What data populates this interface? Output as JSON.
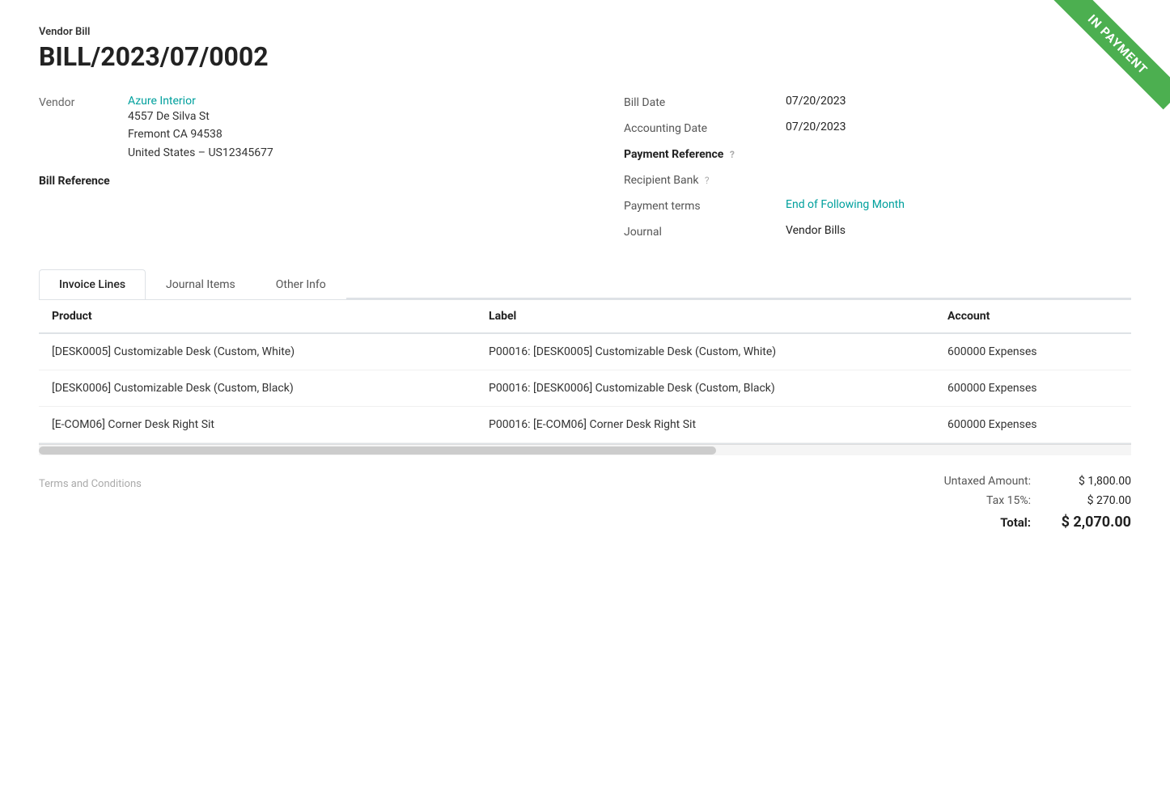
{
  "ribbon": {
    "label": "IN PAYMENT"
  },
  "header": {
    "vendor_bill_label": "Vendor Bill",
    "bill_number": "BILL/2023/07/0002"
  },
  "vendor": {
    "label": "Vendor",
    "name": "Azure Interior",
    "address_line1": "4557 De Silva St",
    "address_line2": "Fremont CA 94538",
    "address_line3": "United States – US12345677"
  },
  "bill_reference": {
    "label": "Bill Reference"
  },
  "fields": {
    "bill_date_label": "Bill Date",
    "bill_date_value": "07/20/2023",
    "accounting_date_label": "Accounting Date",
    "accounting_date_value": "07/20/2023",
    "payment_reference_label": "Payment Reference",
    "payment_reference_help": "?",
    "payment_reference_value": "",
    "recipient_bank_label": "Recipient Bank",
    "recipient_bank_help": "?",
    "recipient_bank_value": "",
    "payment_terms_label": "Payment terms",
    "payment_terms_value": "End of Following Month",
    "journal_label": "Journal",
    "journal_value": "Vendor Bills"
  },
  "tabs": [
    {
      "id": "invoice-lines",
      "label": "Invoice Lines",
      "active": true
    },
    {
      "id": "journal-items",
      "label": "Journal Items",
      "active": false
    },
    {
      "id": "other-info",
      "label": "Other Info",
      "active": false
    }
  ],
  "table": {
    "columns": [
      {
        "id": "product",
        "label": "Product"
      },
      {
        "id": "label",
        "label": "Label"
      },
      {
        "id": "account",
        "label": "Account"
      }
    ],
    "rows": [
      {
        "product": "[DESK0005] Customizable Desk (Custom, White)",
        "label": "P00016: [DESK0005] Customizable Desk (Custom, White)",
        "account": "600000 Expenses"
      },
      {
        "product": "[DESK0006] Customizable Desk (Custom, Black)",
        "label": "P00016: [DESK0006] Customizable Desk (Custom, Black)",
        "account": "600000 Expenses"
      },
      {
        "product": "[E-COM06] Corner Desk Right Sit",
        "label": "P00016: [E-COM06] Corner Desk Right Sit",
        "account": "600000 Expenses"
      }
    ]
  },
  "footer": {
    "terms_label": "Terms and Conditions",
    "untaxed_amount_label": "Untaxed Amount:",
    "untaxed_amount_value": "$ 1,800.00",
    "tax_label": "Tax 15%:",
    "tax_value": "$ 270.00",
    "total_label": "Total:",
    "total_value": "$ 2,070.00"
  }
}
